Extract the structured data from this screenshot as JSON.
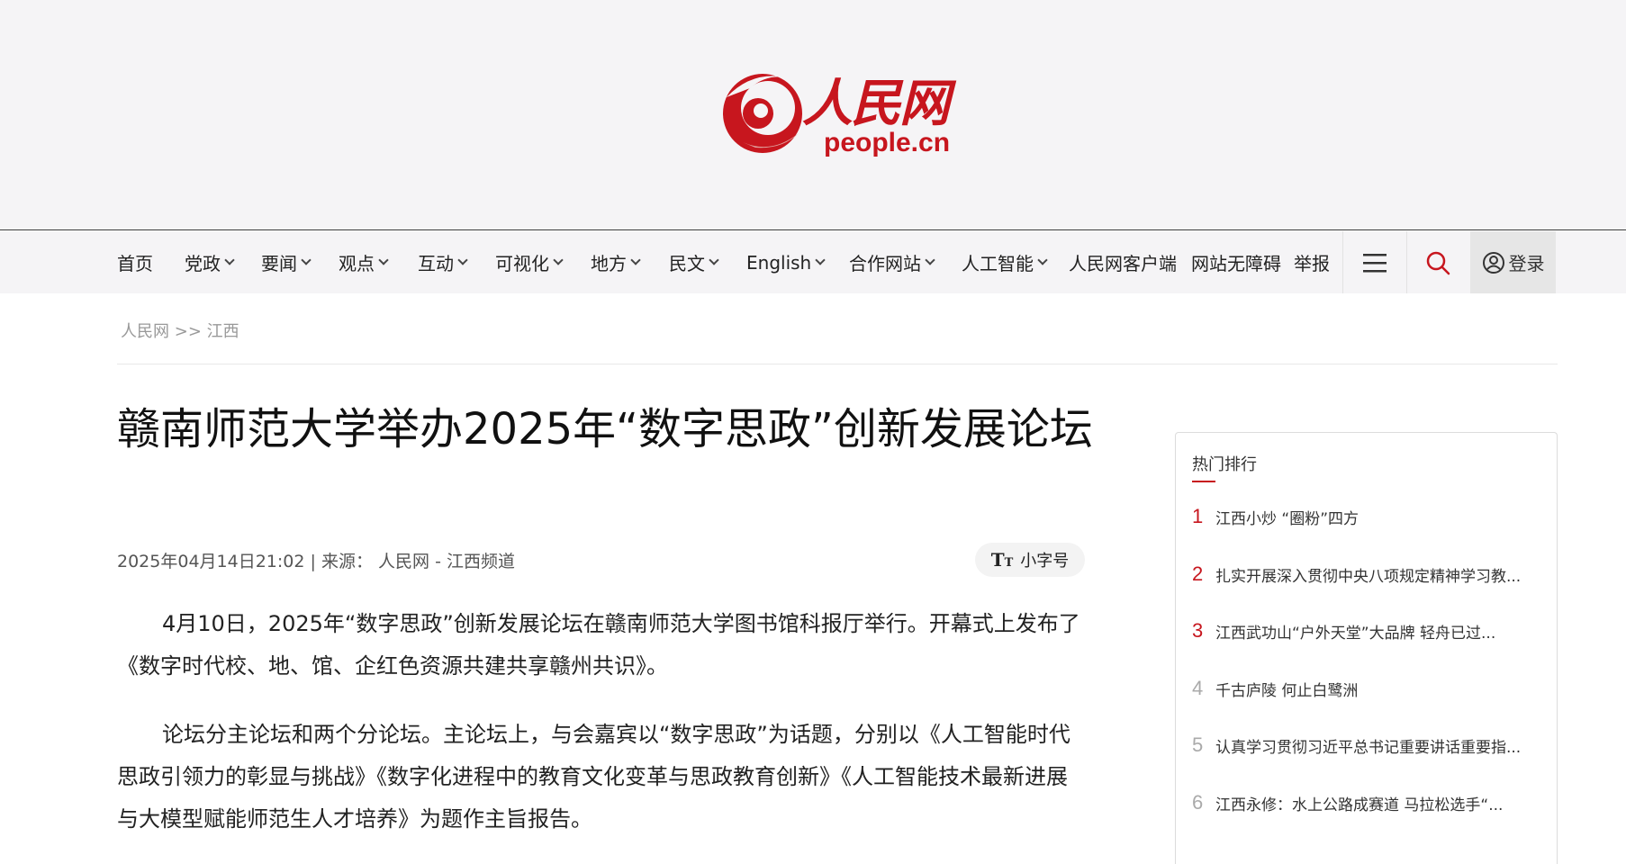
{
  "site": {
    "logo_text": "人民网",
    "logo_domain": "people.cn",
    "brand_color": "#c7161e"
  },
  "nav": {
    "items": [
      {
        "label": "首页",
        "dropdown": false
      },
      {
        "label": "党政",
        "dropdown": true
      },
      {
        "label": "要闻",
        "dropdown": true
      },
      {
        "label": "观点",
        "dropdown": true
      },
      {
        "label": "互动",
        "dropdown": true
      },
      {
        "label": "可视化",
        "dropdown": true
      },
      {
        "label": "地方",
        "dropdown": true
      },
      {
        "label": "民文",
        "dropdown": true
      },
      {
        "label": "English",
        "dropdown": true
      },
      {
        "label": "合作网站",
        "dropdown": true
      },
      {
        "label": "人工智能",
        "dropdown": true
      },
      {
        "label": "人民网客户端",
        "dropdown": false
      },
      {
        "label": "网站无障碍",
        "dropdown": false
      },
      {
        "label": "举报",
        "dropdown": false
      }
    ],
    "login_label": "登录",
    "menu_icon": "hamburger-icon",
    "search_icon": "search-icon"
  },
  "breadcrumb": {
    "home": "人民网",
    "separator": ">>",
    "section": "江西"
  },
  "article": {
    "title": "赣南师范大学举办2025年“数字思政”创新发展论坛",
    "datetime": "2025年04月14日21:02",
    "source_sep": "|",
    "source_label": "来源：",
    "source": "人民网 - 江西频道",
    "font_toggle_label": "小字号",
    "paragraphs": [
      "4月10日，2025年“数字思政”创新发展论坛在赣南师范大学图书馆科报厅举行。开幕式上发布了《数字时代校、地、馆、企红色资源共建共享赣州共识》。",
      "论坛分主论坛和两个分论坛。主论坛上，与会嘉宾以“数字思政”为话题，分别以《人工智能时代思政引领力的彰显与挑战》《数字化进程中的教育文化变革与思政教育创新》《人工智能技术最新进展与大模型赋能师范生人才培养》为题作主旨报告。"
    ]
  },
  "sidebar": {
    "title": "热门排行",
    "items": [
      {
        "rank": "1",
        "text": "江西小炒 “圈粉”四方"
      },
      {
        "rank": "2",
        "text": "扎实开展深入贯彻中央八项规定精神学习教..."
      },
      {
        "rank": "3",
        "text": "江西武功山“户外天堂”大品牌 轻舟已过..."
      },
      {
        "rank": "4",
        "text": "千古庐陵 何止白鹭洲"
      },
      {
        "rank": "5",
        "text": "认真学习贯彻习近平总书记重要讲话重要指..."
      },
      {
        "rank": "6",
        "text": "江西永修：水上公路成赛道 马拉松选手“..."
      }
    ]
  }
}
